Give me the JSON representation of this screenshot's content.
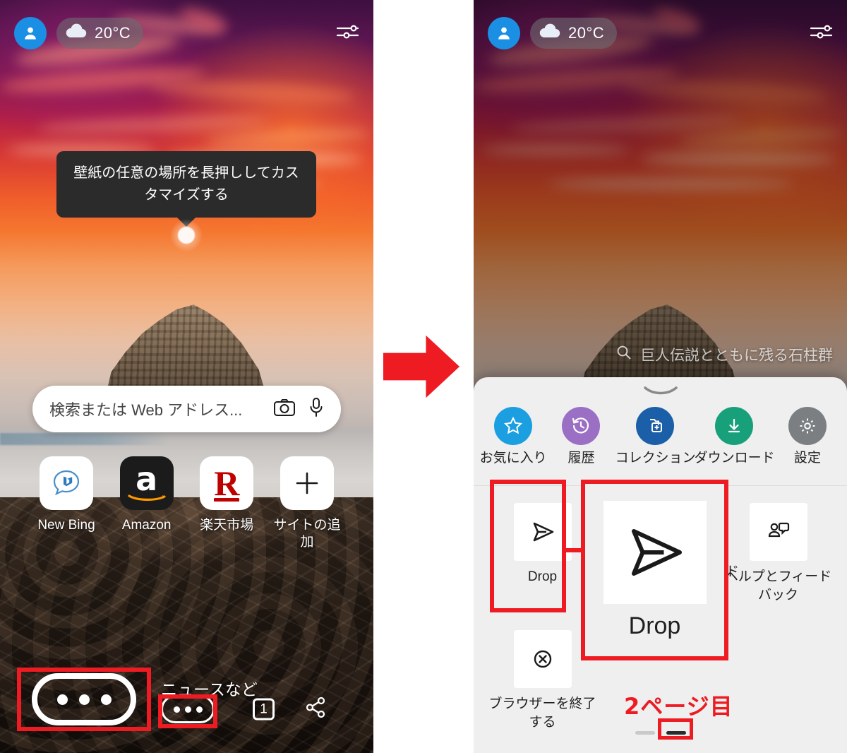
{
  "meta": {
    "accent_red": "#ee1b22",
    "avatar_blue": "#1a8fe3"
  },
  "left_panel": {
    "topbar": {
      "avatar_icon": "person-avatar-icon",
      "weather_icon": "cloud-icon",
      "weather_temp": "20°C",
      "tune_icon": "sliders-icon"
    },
    "tooltip": {
      "text": "壁紙の任意の場所を長押ししてカスタマイズする",
      "touch_indicator": "touch-dot"
    },
    "search": {
      "placeholder": "検索または Web アドレス...",
      "camera_icon": "camera-icon",
      "mic_icon": "microphone-icon"
    },
    "shortcuts": [
      {
        "label": "New Bing",
        "icon": "bing-chat-icon"
      },
      {
        "label": "Amazon",
        "icon": "amazon-icon",
        "glyph": "a"
      },
      {
        "label": "楽天市場",
        "icon": "rakuten-icon",
        "glyph": "R"
      },
      {
        "label": "サイトの追加",
        "icon": "plus-icon"
      }
    ],
    "bottom": {
      "news_label": "ニュースなど",
      "menu_icon": "more-dots-icon",
      "tab_count": "1",
      "share_icon": "share-icon"
    },
    "annotation": {
      "zoom_box_label": "more-dots-zoom-callout",
      "highlight_label": "more-dots-highlight"
    }
  },
  "flow_arrow": {
    "icon": "right-arrow-icon",
    "color": "#ee1b22"
  },
  "right_panel": {
    "topbar": {
      "avatar_icon": "person-avatar-icon",
      "weather_icon": "cloud-icon",
      "weather_temp": "20°C",
      "tune_icon": "sliders-icon"
    },
    "wallpaper_caption": {
      "search_icon": "search-icon",
      "text": "巨人伝説とともに残る石柱群"
    },
    "sheet": {
      "handle_icon": "drag-handle-icon",
      "menu_row": [
        {
          "label": "お気に入り",
          "icon": "star-icon",
          "color": "#1b9fe0"
        },
        {
          "label": "履歴",
          "icon": "history-clock-icon",
          "color": "#9a6fc4"
        },
        {
          "label": "コレクション",
          "icon": "collections-icon",
          "color": "#1a5fa8"
        },
        {
          "label": "ダウンロード",
          "icon": "download-icon",
          "color": "#18a07a"
        },
        {
          "label": "設定",
          "icon": "gear-icon",
          "color": "#7b7f82"
        }
      ],
      "grid": [
        {
          "label": "Drop",
          "icon": "send-paper-plane-icon"
        },
        {
          "label": "",
          "icon": ""
        },
        {
          "label": "ヘルプとフィードバック",
          "icon": "help-feedback-icon"
        },
        {
          "label": "ブラウザーを終了する",
          "icon": "close-circle-icon"
        }
      ],
      "obscured_label_fragment": "ド",
      "page_dots": {
        "count": 2,
        "active_index": 1
      }
    },
    "annotations": {
      "drop_box_label": "drop-item-highlight",
      "drop_zoom_label": "Drop",
      "drop_zoom_icon": "send-paper-plane-icon",
      "page_note": "2ページ目",
      "page_dot_box_label": "page-dot-highlight"
    }
  }
}
